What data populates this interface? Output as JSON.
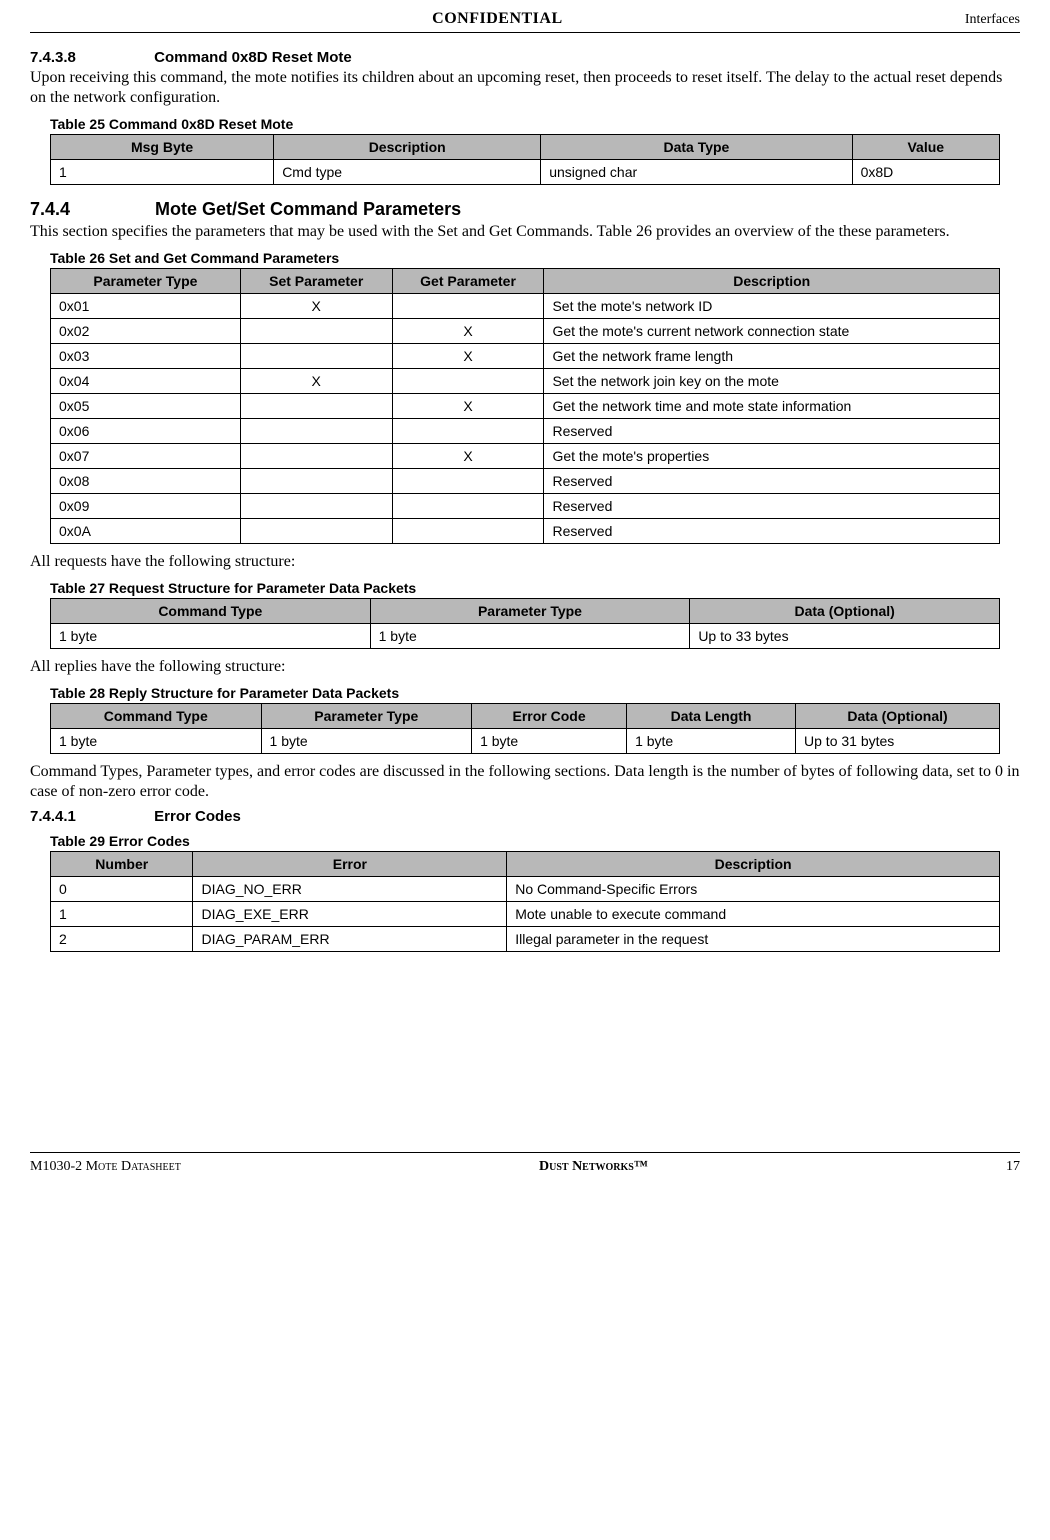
{
  "header": {
    "center": "CONFIDENTIAL",
    "right": "Interfaces"
  },
  "sec_74308": {
    "num": "7.4.3.8",
    "title": "Command 0x8D Reset Mote",
    "body": "Upon receiving this command, the mote notifies its children about an upcoming reset, then proceeds to reset itself. The delay to the actual reset depends on the network configuration."
  },
  "table25": {
    "caption": "Table 25    Command 0x8D Reset Mote",
    "headers": [
      "Msg Byte",
      "Description",
      "Data Type",
      "Value"
    ],
    "rows": [
      [
        "1",
        "Cmd type",
        "unsigned char",
        "0x8D"
      ]
    ]
  },
  "sec_744": {
    "num": "7.4.4",
    "title": "Mote Get/Set Command Parameters",
    "body": "This section specifies the parameters that may be used with the Set and Get Commands. Table 26 provides an overview of the these parameters."
  },
  "table26": {
    "caption": "Table 26    Set and Get Command Parameters",
    "headers": [
      "Parameter Type",
      "Set Parameter",
      "Get Parameter",
      "Description"
    ],
    "rows": [
      [
        "0x01",
        "X",
        "",
        "Set the mote's network ID"
      ],
      [
        "0x02",
        "",
        "X",
        "Get the mote's current network connection state"
      ],
      [
        "0x03",
        "",
        "X",
        "Get the network frame length"
      ],
      [
        "0x04",
        "X",
        "",
        "Set the network join key on the mote"
      ],
      [
        "0x05",
        "",
        "X",
        "Get the network time and mote state information"
      ],
      [
        "0x06",
        "",
        "",
        "Reserved"
      ],
      [
        "0x07",
        "",
        "X",
        "Get the mote's properties"
      ],
      [
        "0x08",
        "",
        "",
        "Reserved"
      ],
      [
        "0x09",
        "",
        "",
        "Reserved"
      ],
      [
        "0x0A",
        "",
        "",
        "Reserved"
      ]
    ]
  },
  "requests_text": "All requests have the following structure:",
  "table27": {
    "caption": "Table 27    Request Structure for Parameter Data Packets",
    "headers": [
      "Command Type",
      "Parameter Type",
      "Data (Optional)"
    ],
    "rows": [
      [
        "1 byte",
        "1 byte",
        "Up to 33 bytes"
      ]
    ]
  },
  "replies_text": "All replies have the following structure:",
  "table28": {
    "caption": "Table 28    Reply Structure for Parameter Data Packets",
    "headers": [
      "Command Type",
      "Parameter Type",
      "Error Code",
      "Data Length",
      "Data (Optional)"
    ],
    "rows": [
      [
        "1 byte",
        "1 byte",
        "1 byte",
        "1 byte",
        "Up to 31 bytes"
      ]
    ]
  },
  "cmd_types_text": "Command Types, Parameter types, and error codes are discussed in the following sections. Data length is the number of bytes of following data, set to 0 in case of non-zero error code.",
  "sec_7441": {
    "num": "7.4.4.1",
    "title": "Error Codes"
  },
  "table29": {
    "caption": "Table 29    Error Codes",
    "headers": [
      "Number",
      "Error",
      "Description"
    ],
    "rows": [
      [
        "0",
        "DIAG_NO_ERR",
        "No Command-Specific Errors"
      ],
      [
        "1",
        "DIAG_EXE_ERR",
        "Mote unable to execute command"
      ],
      [
        "2",
        "DIAG_PARAM_ERR",
        "Illegal parameter in the request"
      ]
    ]
  },
  "footer": {
    "left": "M1030-2 Mote Datasheet",
    "center": "Dust Networks™",
    "right": "17"
  }
}
